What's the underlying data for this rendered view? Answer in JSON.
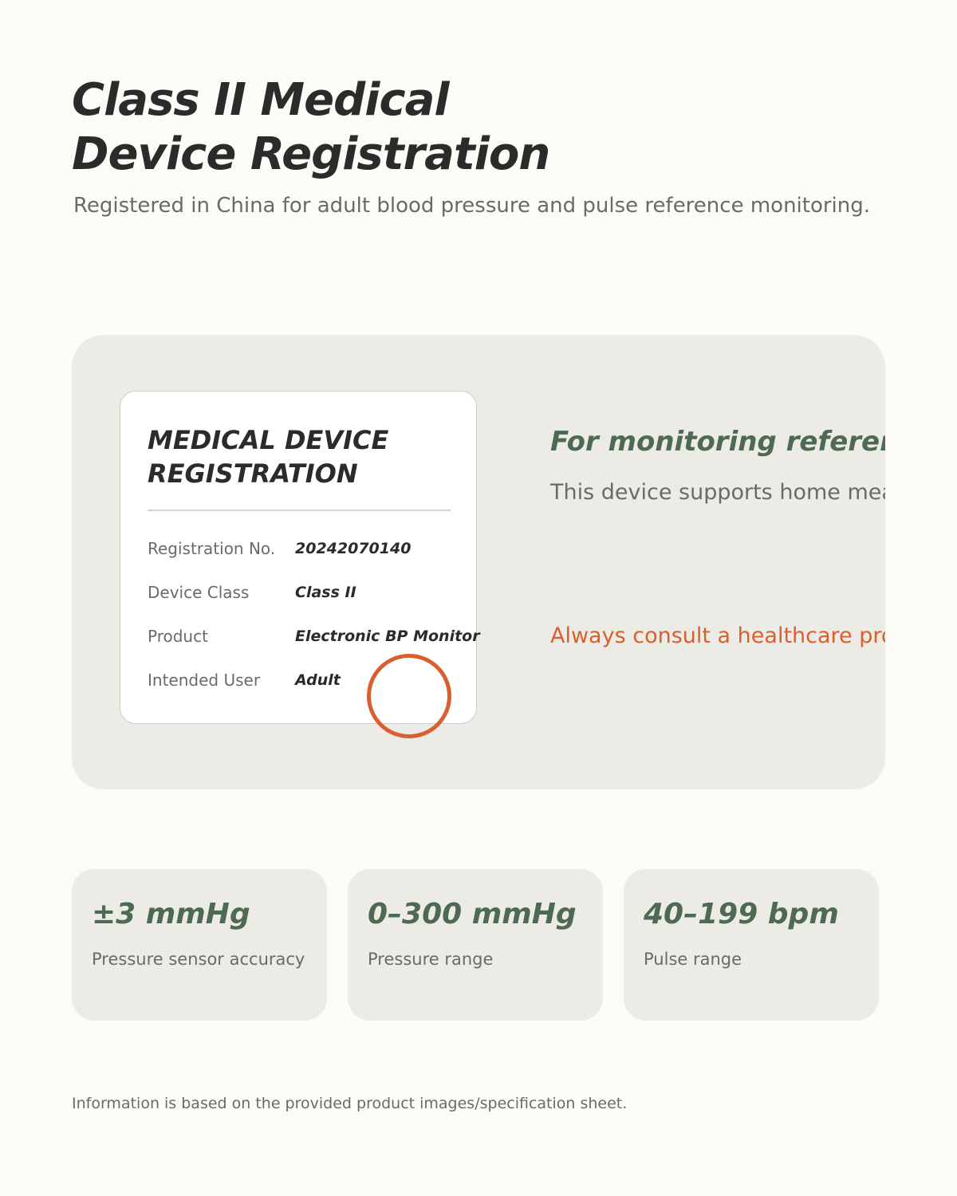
{
  "header": {
    "title_line1": "Class II Medical",
    "title_line2": "Device Registration",
    "subtitle": "Registered in China for adult blood pressure and pulse reference monitoring."
  },
  "registration_card": {
    "title_line1": "MEDICAL DEVICE",
    "title_line2": "REGISTRATION",
    "rows": [
      {
        "label": "Registration No.",
        "value": "20242070140"
      },
      {
        "label": "Device Class",
        "value": "Class II"
      },
      {
        "label": "Product",
        "value": "Electronic BP Monitor"
      },
      {
        "label": "Intended User",
        "value": "Adult"
      }
    ]
  },
  "panel": {
    "heading": "For monitoring reference",
    "body": "This device supports home measuremen",
    "warning": "Always consult a healthcare professional f"
  },
  "specs": [
    {
      "value": "±3 mmHg",
      "label": "Pressure sensor accuracy"
    },
    {
      "value": "0–300 mmHg",
      "label": "Pressure range"
    },
    {
      "value": "40–199 bpm",
      "label": "Pulse range"
    }
  ],
  "footnote": "Information is based on the provided product images/specification sheet.",
  "colors": {
    "background": "#fcfbf6",
    "panel": "#edebe6",
    "accent_green": "#4f6a52",
    "accent_orange": "#d9602e",
    "text_dark": "#2b2b2b",
    "text_muted": "#6a6a66"
  }
}
